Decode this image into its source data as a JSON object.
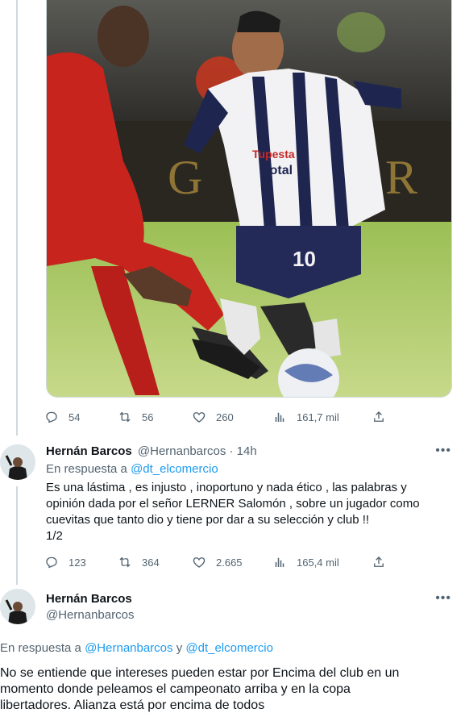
{
  "tweet1": {
    "stats": {
      "replies": "54",
      "retweets": "56",
      "likes": "260",
      "views": "161,7 mil"
    }
  },
  "reply1": {
    "name": "Hernán Barcos",
    "handle": "@Hernanbarcos",
    "time": "· 14h",
    "reply_prefix": "En respuesta a ",
    "reply_to": "@dt_elcomercio",
    "text_lines": [
      "Es una lástima , es injusto , inoportuno y nada ético , las palabras y",
      "opinión dada por el señor LERNER Salomón , sobre un jugador como",
      "cuevitas que tanto dio y tiene por dar a su selección y club !!",
      "1/2"
    ],
    "stats": {
      "replies": "123",
      "retweets": "364",
      "likes": "2.665",
      "views": "165,4 mil"
    }
  },
  "reply2": {
    "name": "Hernán Barcos",
    "handle": "@Hernanbarcos",
    "reply_prefix": "En respuesta a ",
    "reply_to_1": "@Hernanbarcos",
    "reply_and": " y ",
    "reply_to_2": "@dt_elcomercio",
    "text_lines": [
      "No se entiende que intereses pueden estar por Encima del club en un",
      "momento donde peleamos el campeonato arriba y en la copa",
      "libertadores. Alianza está por encima de todos"
    ]
  },
  "photo": {
    "jersey_text": "Tupesta Total",
    "number": "10"
  },
  "colors": {
    "accent": "#1d9bf0",
    "muted": "#536471",
    "text": "#0f1419"
  }
}
